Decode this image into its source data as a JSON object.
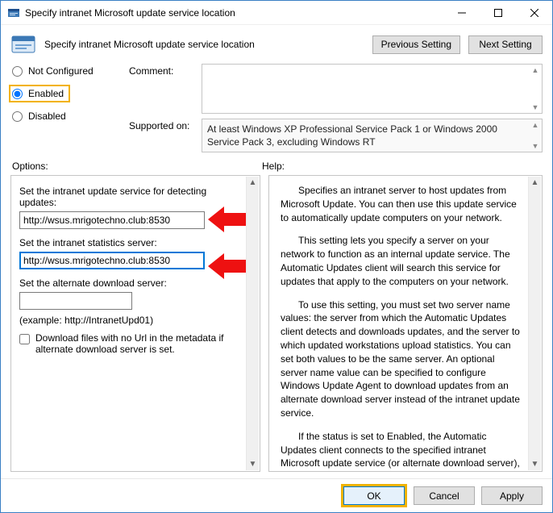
{
  "window": {
    "title": "Specify intranet Microsoft update service location"
  },
  "header": {
    "title": "Specify intranet Microsoft update service location",
    "prev": "Previous Setting",
    "next": "Next Setting"
  },
  "status": {
    "not_configured": "Not Configured",
    "enabled": "Enabled",
    "disabled": "Disabled",
    "selected": "enabled"
  },
  "meta": {
    "comment_label": "Comment:",
    "comment_value": "",
    "supported_label": "Supported on:",
    "supported_value": "At least Windows XP Professional Service Pack 1 or Windows 2000 Service Pack 3, excluding Windows RT"
  },
  "sections": {
    "options": "Options:",
    "help": "Help:"
  },
  "options": {
    "update_service_label": "Set the intranet update service for detecting updates:",
    "update_service_value": "http://wsus.mrigotechno.club:8530",
    "stats_server_label": "Set the intranet statistics server:",
    "stats_server_value": "http://wsus.mrigotechno.club:8530",
    "alt_server_label": "Set the alternate download server:",
    "alt_server_value": "",
    "example": "(example: http://IntranetUpd01)",
    "checkbox_label": "Download files with no Url in the metadata if alternate download server is set."
  },
  "help": {
    "p1": "Specifies an intranet server to host updates from Microsoft Update. You can then use this update service to automatically update computers on your network.",
    "p2": "This setting lets you specify a server on your network to function as an internal update service. The Automatic Updates client will search this service for updates that apply to the computers on your network.",
    "p3": "To use this setting, you must set two server name values: the server from which the Automatic Updates client detects and downloads updates, and the server to which updated workstations upload statistics. You can set both values to be the same server. An optional server name value can be specified to configure Windows Update Agent to download updates from an alternate download server instead of the intranet update service.",
    "p4": "If the status is set to Enabled, the Automatic Updates client connects to the specified intranet Microsoft update service (or alternate download server), instead of Windows Update, to"
  },
  "footer": {
    "ok": "OK",
    "cancel": "Cancel",
    "apply": "Apply"
  }
}
